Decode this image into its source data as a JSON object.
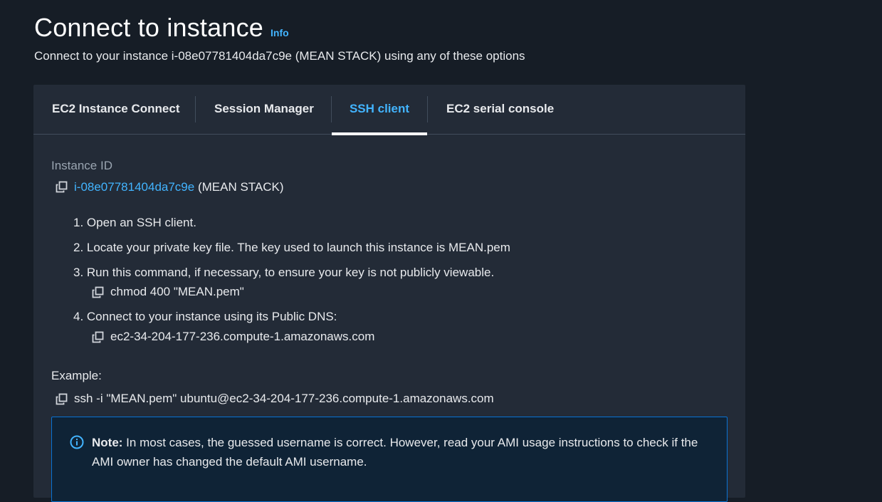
{
  "header": {
    "title": "Connect to instance",
    "info_label": "Info",
    "subtitle": "Connect to your instance i-08e07781404da7c9e (MEAN STACK) using any of these options"
  },
  "tabs": [
    {
      "label": "EC2 Instance Connect",
      "active": false
    },
    {
      "label": "Session Manager",
      "active": false
    },
    {
      "label": "SSH client",
      "active": true
    },
    {
      "label": "EC2 serial console",
      "active": false
    }
  ],
  "ssh": {
    "instance_id_label": "Instance ID",
    "instance_id": "i-08e07781404da7c9e",
    "instance_name": "(MEAN STACK)",
    "steps": [
      "1. Open an SSH client.",
      "2. Locate your private key file. The key used to launch this instance is MEAN.pem",
      "3. Run this command, if necessary, to ensure your key is not publicly viewable.",
      "4. Connect to your instance using its Public DNS:"
    ],
    "chmod_command": "chmod 400 \"MEAN.pem\"",
    "public_dns": "ec2-34-204-177-236.compute-1.amazonaws.com",
    "example_label": "Example:",
    "example_command": "ssh -i \"MEAN.pem\" ubuntu@ec2-34-204-177-236.compute-1.amazonaws.com"
  },
  "note": {
    "label": "Note:",
    "text": " In most cases, the guessed username is correct. However, read your AMI usage instructions to check if the AMI owner has changed the default AMI username."
  },
  "colors": {
    "background": "#161d26",
    "panel": "#232b37",
    "accent": "#42b4ff",
    "note_bg": "#0f2336",
    "note_border": "#0972d3"
  },
  "icons": {
    "copy": "copy-icon",
    "info": "info-circle-icon"
  }
}
